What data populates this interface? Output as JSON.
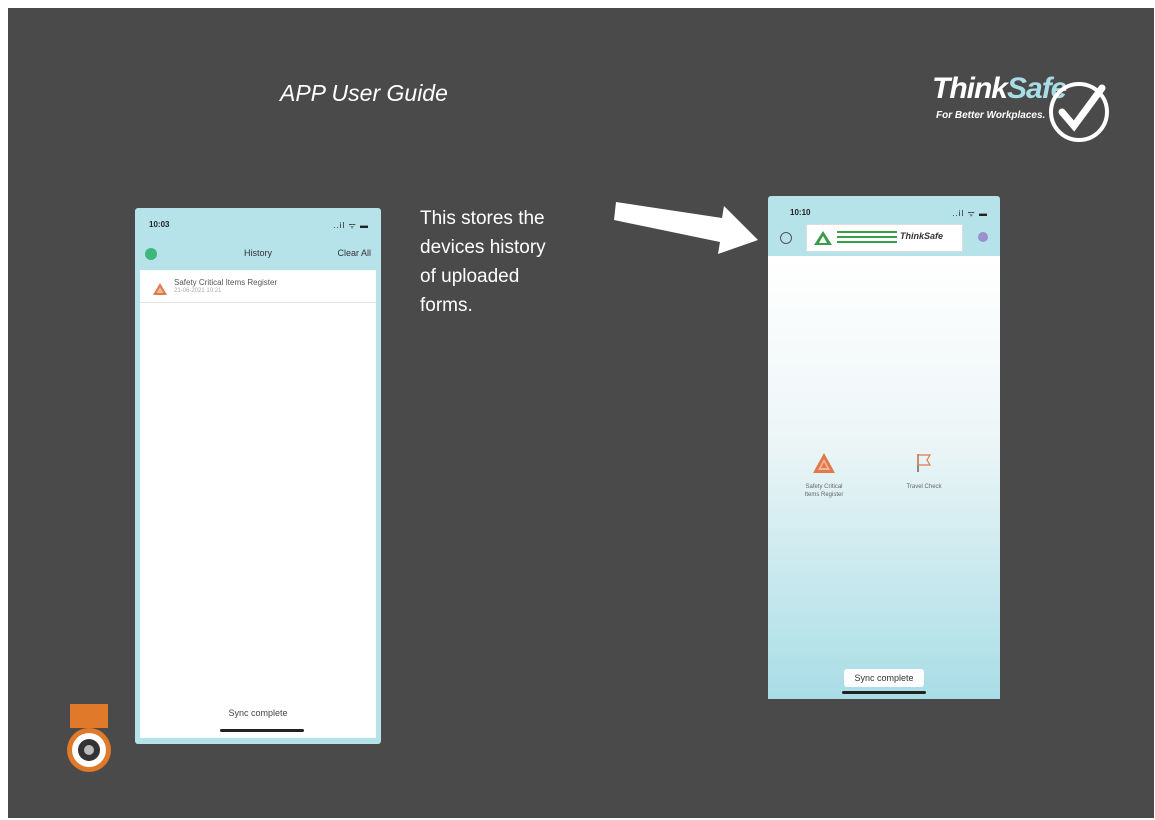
{
  "slide": {
    "title": "APP User Guide",
    "note": [
      "This stores the",
      "devices history",
      "of uploaded",
      "forms."
    ]
  },
  "logo": {
    "brand_a": "Think",
    "brand_b": "Safe",
    "tagline": "For Better Workplaces."
  },
  "left_phone": {
    "time": "10:03",
    "status_icons": "..il ᯤ ▬",
    "header_title": "History",
    "clear_all": "Clear All",
    "history_items": [
      {
        "label": "Safety Critical Items Register",
        "sub": "21-06-2021 10:21"
      }
    ],
    "sync_status": "Sync complete"
  },
  "right_phone": {
    "time": "10:10",
    "status_icons": "..il ᯤ ▬",
    "banner_logo": "ThinkSafe",
    "tiles": [
      {
        "label_line1": "Safety Critical",
        "label_line2": "Items Register",
        "icon": "warning-triangle-icon"
      },
      {
        "label_line1": "Travel Check",
        "label_line2": "",
        "icon": "flag-icon"
      }
    ],
    "sync_status": "Sync complete"
  },
  "colors": {
    "slide_bg": "#4a4a4a",
    "phone_frame": "#b6e3ea",
    "accent_green": "#3db77a",
    "warning_orange": "#e07a4a"
  }
}
